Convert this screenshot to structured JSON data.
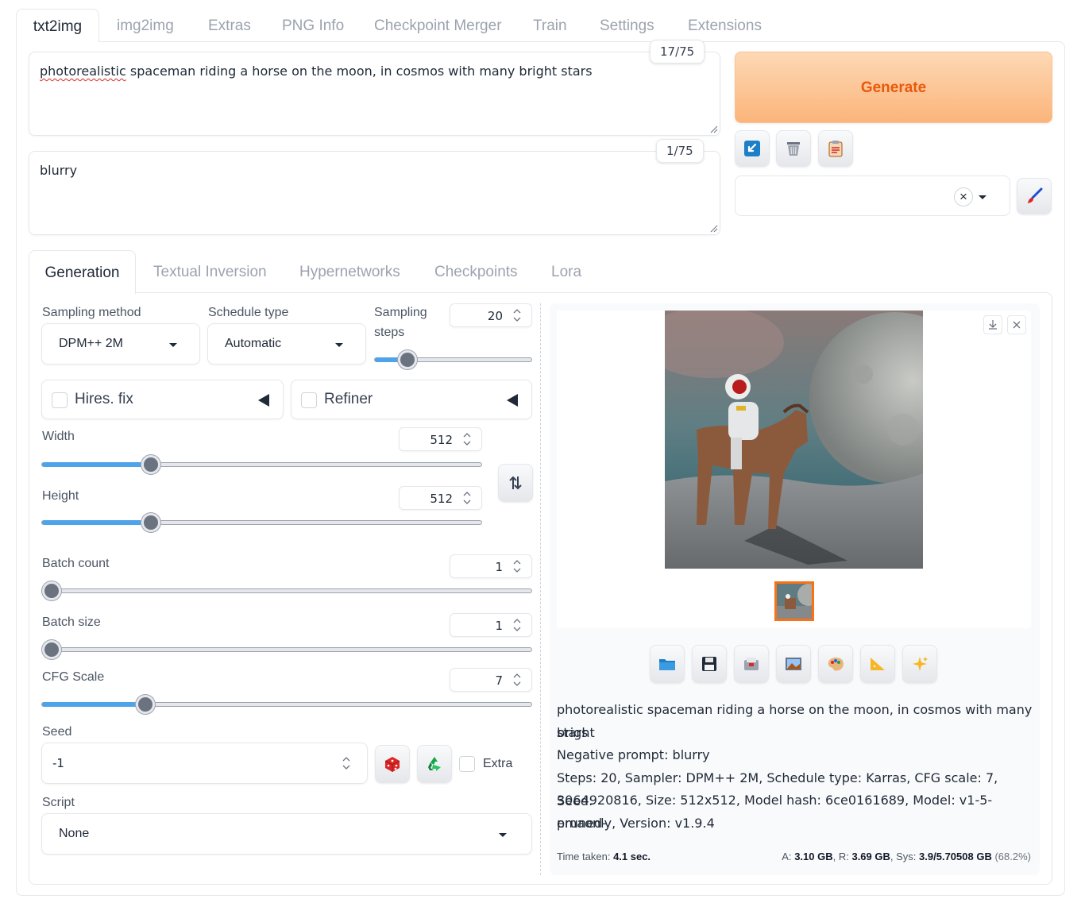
{
  "top_tabs": [
    "txt2img",
    "img2img",
    "Extras",
    "PNG Info",
    "Checkpoint Merger",
    "Train",
    "Settings",
    "Extensions"
  ],
  "prompt": {
    "text_first": "photorealistic",
    "text_rest": " spaceman riding a horse on the moon, in cosmos with many bright stars",
    "token_count": "17/75"
  },
  "negative_prompt": {
    "text": "blurry",
    "token_count": "1/75"
  },
  "actions": {
    "generate_label": "Generate",
    "tool_icons": [
      "arrow-icon",
      "trash-icon",
      "clipboard-icon"
    ],
    "styles_value": "",
    "clear_icon": "×",
    "edit_icon": "paintbrush-icon"
  },
  "sub_tabs": [
    "Generation",
    "Textual Inversion",
    "Hypernetworks",
    "Checkpoints",
    "Lora"
  ],
  "form": {
    "sampling_method": {
      "label": "Sampling method",
      "value": "DPM++ 2M"
    },
    "schedule_type": {
      "label": "Schedule type",
      "value": "Automatic"
    },
    "sampling_steps": {
      "label_line1": "Sampling",
      "label_line2": "steps",
      "value": "20",
      "fraction": 0.17
    },
    "hires_fix": {
      "label": "Hires. fix",
      "checked": false
    },
    "refiner": {
      "label": "Refiner",
      "checked": false
    },
    "width": {
      "label": "Width",
      "value": "512",
      "fraction": 0.237
    },
    "height": {
      "label": "Height",
      "value": "512",
      "fraction": 0.237
    },
    "batch_count": {
      "label": "Batch count",
      "value": "1",
      "fraction": 0.0
    },
    "batch_size": {
      "label": "Batch size",
      "value": "1",
      "fraction": 0.0
    },
    "cfg_scale": {
      "label": "CFG Scale",
      "value": "7",
      "fraction": 0.2
    },
    "seed": {
      "label": "Seed",
      "value": "-1",
      "extra_label": "Extra"
    },
    "script": {
      "label": "Script",
      "value": "None"
    }
  },
  "output": {
    "action_icons": [
      "folder-icon",
      "save-icon",
      "zip-icon",
      "image-icon",
      "palette-icon",
      "ruler-icon",
      "sparkle-icon"
    ],
    "info_line1": "photorealistic spaceman riding a horse on the moon, in cosmos with many bright",
    "info_line2": "stars",
    "info_line3": "Negative prompt: blurry",
    "info_line4": "Steps: 20, Sampler: DPM++ 2M, Schedule type: Karras, CFG scale: 7, Seed:",
    "info_line5": "3064920816, Size: 512x512, Model hash: 6ce0161689, Model: v1-5-pruned-",
    "info_line6": "emaonly, Version: v1.9.4",
    "time_label": "Time taken:",
    "time_value": "4.1 sec.",
    "mem_a_label": "A:",
    "mem_a": "3.10 GB",
    "mem_r_label": "R:",
    "mem_r": "3.69 GB",
    "mem_sys_label": "Sys:",
    "mem_sys": "3.9/5.70508 GB",
    "mem_pct": "(68.2%)"
  },
  "colors": {
    "accent": "#ea580c",
    "slider_fill": "#4fa3e8"
  }
}
